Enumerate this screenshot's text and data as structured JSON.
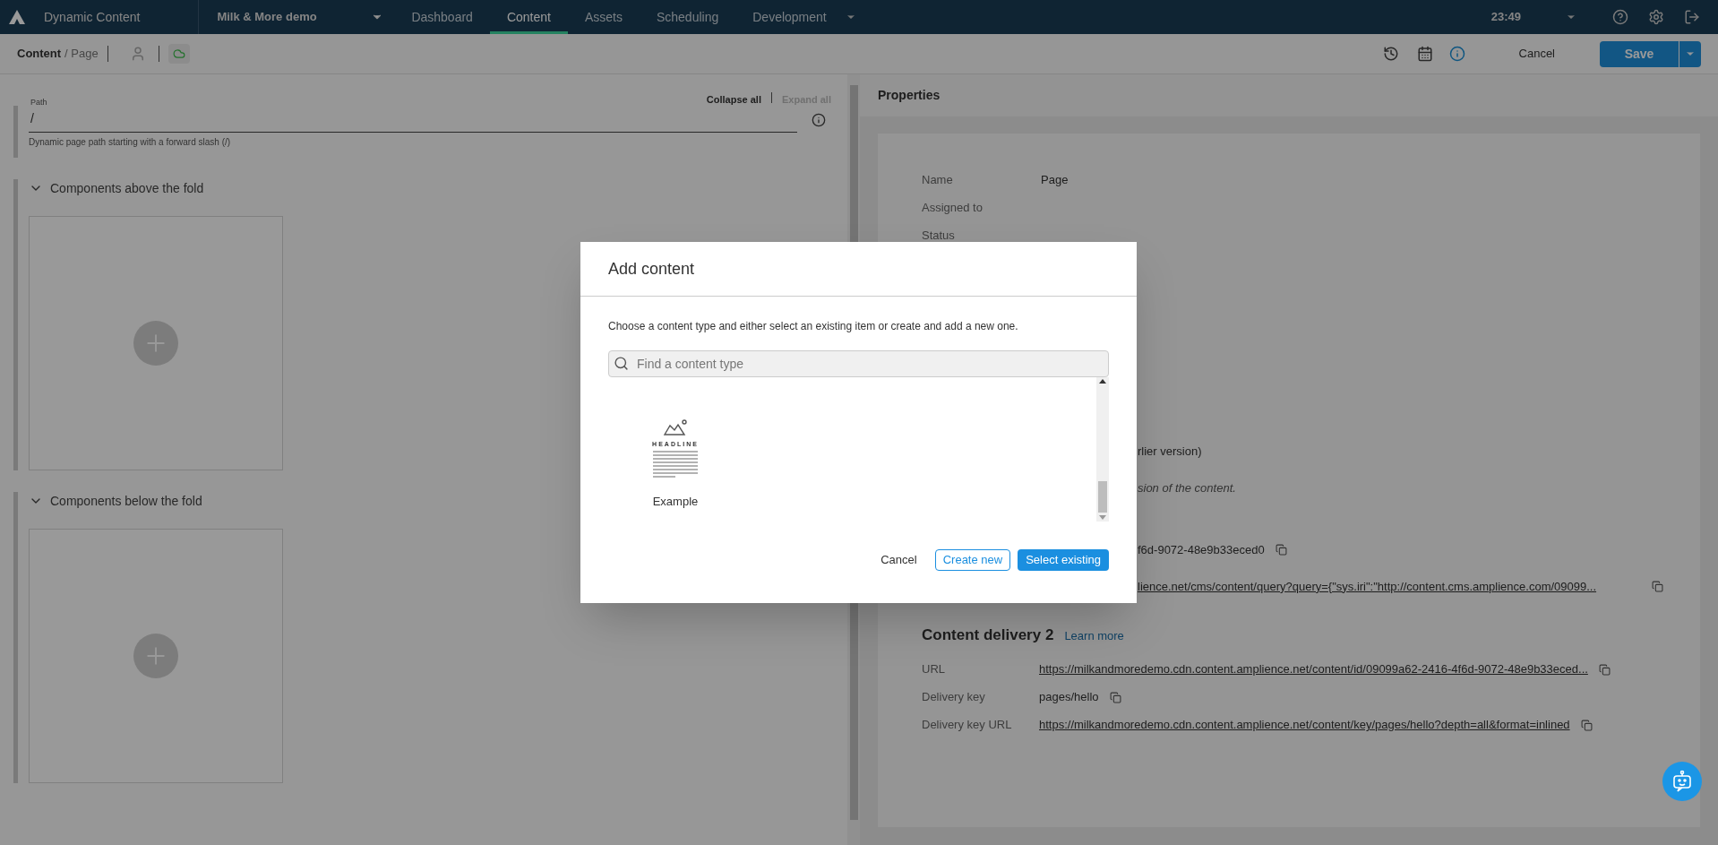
{
  "top_bar": {
    "app_name": "Dynamic Content",
    "project": "Milk & More demo",
    "tabs": [
      {
        "label": "Dashboard",
        "selected": false
      },
      {
        "label": "Content",
        "selected": true
      },
      {
        "label": "Assets",
        "selected": false
      },
      {
        "label": "Scheduling",
        "selected": false
      },
      {
        "label": "Development",
        "selected": false
      }
    ],
    "time": "23:49"
  },
  "sub_bar": {
    "section": "Content",
    "page": "/ Page",
    "cancel": "Cancel",
    "save": "Save"
  },
  "editor": {
    "collapse_all": {
      "label": "Collapse all",
      "disabled": false
    },
    "expand_all": {
      "label": "Expand all",
      "disabled": true
    },
    "path": {
      "label": "Path",
      "value": "/",
      "hint": "Dynamic page path starting with a forward slash (/)"
    },
    "sections": [
      {
        "title": "Components above the fold",
        "expanded": true
      },
      {
        "title": "Components below the fold",
        "expanded": true
      }
    ]
  },
  "properties": {
    "title": "Properties",
    "rows": [
      {
        "label": "Name",
        "value": "Page"
      },
      {
        "label": "Assigned to"
      },
      {
        "label": "Status"
      }
    ],
    "partial_rows": [
      {
        "kind": "plain",
        "text": "rlier version)"
      },
      {
        "kind": "italic",
        "text": "sion of the content."
      },
      {
        "kind": "id",
        "text": "f6d-9072-48e9b33eced0"
      },
      {
        "kind": "link",
        "text": "lience.net/cms/content/query?query={\"sys.iri\":\"http://content.cms.amplience.com/09099..."
      }
    ],
    "delivery": {
      "title": "Content delivery 2",
      "learn_more": "Learn more",
      "rows": [
        {
          "label": "URL",
          "value": "https://milkandmoredemo.cdn.content.amplience.net/content/id/09099a62-2416-4f6d-9072-48e9b33eced...",
          "kind": "link"
        },
        {
          "label": "Delivery key",
          "value": "pages/hello",
          "kind": "text"
        },
        {
          "label": "Delivery key URL",
          "value": "https://milkandmoredemo.cdn.content.amplience.net/content/key/pages/hello?depth=all&format=inlined",
          "kind": "link"
        }
      ]
    }
  },
  "modal": {
    "title": "Add content",
    "description": "Choose a content type and either select an existing item or create and add a new one.",
    "search": {
      "placeholder": "Find a content type"
    },
    "items": [
      {
        "label": "Example",
        "icon_caption": "HEADLINE"
      }
    ],
    "cancel": "Cancel",
    "create": "Create new",
    "select": "Select existing"
  }
}
